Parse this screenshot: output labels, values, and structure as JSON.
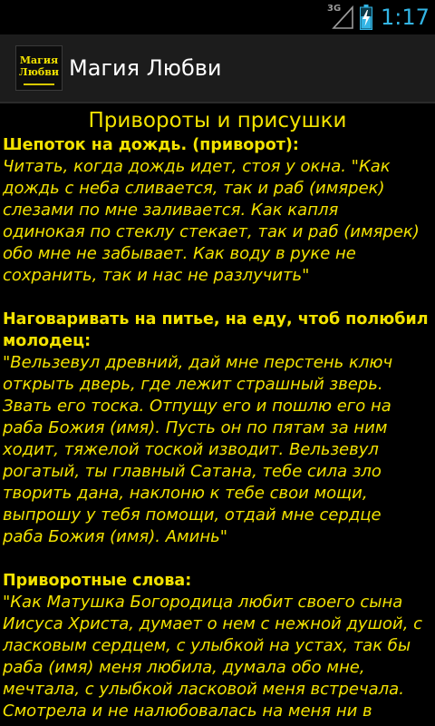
{
  "status": {
    "network": "3G",
    "time": "1:17",
    "signal_icon": "signal-icon",
    "battery_icon": "battery-charging-icon"
  },
  "app": {
    "icon_text_line1": "Магия",
    "icon_text_line2": "Любви",
    "title": "Магия Любви"
  },
  "page": {
    "heading": "Привороты и присушки",
    "sections": [
      {
        "title": "Шепоток на дождь. (приворот):",
        "text": "Читать, когда дождь идет, стоя у окна. \"Как\nдождь с неба сливается, так и раб (имярек)\nслезами по мне заливается. Как капля\nодинокая по стеклу стекает, так и раб (имярек)\nобо мне не забывает. Как воду в руке не\nсохранить, так и нас не разлучить\""
      },
      {
        "title": "Наговаривать на питье, на еду, чтоб полюбил\nмолодец:",
        "text": "\"Вельзевул древний, дай мне перстень ключ\nоткрыть дверь, где лежит страшный зверь.\nЗвать его тоска. Отпущу его и пошлю его на\nраба Божия (имя). Пусть он по пятам за ним\nходит, тяжелой тоской изводит. Вельзевул\nрогатый, ты главный Сатана, тебе сила зло\nтворить дана, наклоню к тебе свои мощи,\nвыпрошу у тебя помощи, отдай мне сердце\nраба Божия (имя). Аминь\""
      },
      {
        "title": "Приворотные слова:",
        "text": "\"Как Матушка Богородица любит своего сына\nИисуса Христа, думает о нем с нежной душой, с\nласковым сердцем, с улыбкой на устах, так бы\nраба (имя) меня любила, думала обо мне,\nмечтала, с улыбкой ласковой меня встречала.\nСмотрела и не налюбовалась на меня ни в"
      }
    ]
  },
  "colors": {
    "text": "#f2e200",
    "background": "#000000",
    "action_bar": "#1c1c1c",
    "clock": "#33b5e5"
  }
}
